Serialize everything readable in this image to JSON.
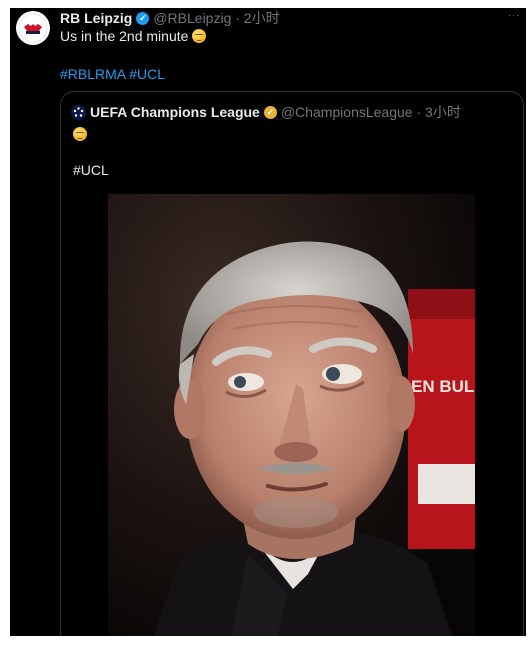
{
  "tweet": {
    "author_name": "RB Leipzig",
    "handle_time": "@RBLeipzig · 2小时",
    "text": "Us in the 2nd minute",
    "emoji": "face-with-rolling-eyes",
    "hashtags": "#RBLRMA #UCL",
    "more_label": "···"
  },
  "quoted": {
    "author_name": "UEFA Champions League",
    "handle_time": "@ChampionsLeague · 3小时",
    "emoji": "face-with-rolling-eyes",
    "hashtag": "#UCL",
    "banner_text": "EN BULL"
  },
  "colors": {
    "background": "#000000",
    "text": "#e7e9ea",
    "muted": "#71767b",
    "link": "#1d9bf0",
    "verified_blue": "#1d9bf0",
    "verified_gold": "#e8b339"
  }
}
